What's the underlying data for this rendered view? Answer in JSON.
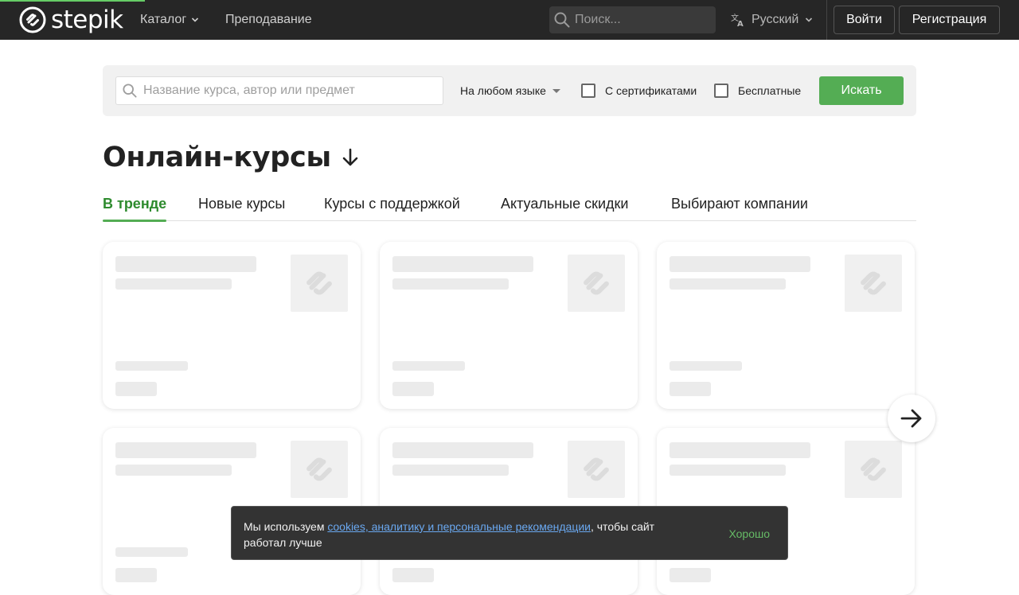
{
  "header": {
    "logo_text": "stepik",
    "nav": {
      "catalog_label": "Каталог",
      "teaching_label": "Преподавание"
    },
    "search": {
      "placeholder": "Поиск..."
    },
    "language_label": "Русский",
    "login_label": "Войти",
    "register_label": "Регистрация"
  },
  "filters": {
    "search_placeholder": "Название курса, автор или предмет",
    "language_select": "На любом языке",
    "certificates_label": "С сертификатами",
    "free_label": "Бесплатные",
    "search_button": "Искать"
  },
  "main": {
    "title": "Онлайн-курсы",
    "tabs": [
      {
        "label": "В тренде",
        "active": true
      },
      {
        "label": "Новые курсы",
        "active": false
      },
      {
        "label": "Курсы с поддержкой",
        "active": false
      },
      {
        "label": "Актуальные скидки",
        "active": false
      },
      {
        "label": "Выбирают компании",
        "active": false
      }
    ]
  },
  "cookie_banner": {
    "text_before": "Мы используем ",
    "link_text": "cookies, аналитику и персональные рекомендации",
    "text_after": ", чтобы сайт работал лучше",
    "ok_label": "Хорошо"
  },
  "colors": {
    "topbar": "#262626",
    "accent_green": "#54ad54",
    "active_tab": "#2e8b2e",
    "link_blue": "#6aa8f0"
  },
  "icons": [
    "stepik-logo-icon",
    "chevron-down-icon",
    "search-icon",
    "translate-icon",
    "arrow-down-icon",
    "arrow-right-icon",
    "stepik-placeholder-icon"
  ]
}
